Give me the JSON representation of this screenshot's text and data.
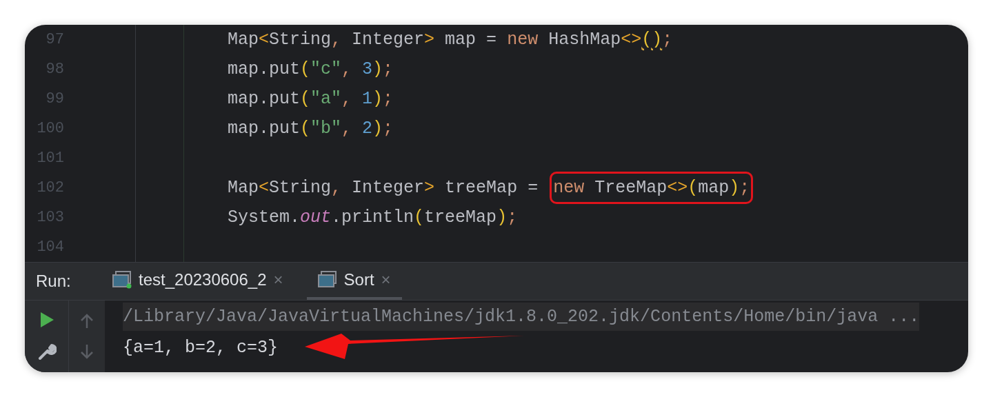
{
  "editor": {
    "lines": [
      {
        "number": "97",
        "tokens": [
          {
            "t": "Map",
            "kind": "plain"
          },
          {
            "t": "<",
            "kind": "angle"
          },
          {
            "t": "String",
            "kind": "plain"
          },
          {
            "t": ",",
            "kind": "punct"
          },
          {
            "t": " Integer",
            "kind": "plain"
          },
          {
            "t": ">",
            "kind": "angle"
          },
          {
            "t": " map = ",
            "kind": "plain"
          },
          {
            "t": "new",
            "kind": "keyword"
          },
          {
            "t": " HashMap",
            "kind": "plain"
          },
          {
            "t": "<>",
            "kind": "angle"
          },
          {
            "t": "()",
            "kind": "warn"
          },
          {
            "t": ";",
            "kind": "punct"
          }
        ]
      },
      {
        "number": "98",
        "tokens": [
          {
            "t": "map.put",
            "kind": "plain"
          },
          {
            "t": "(",
            "kind": "paren"
          },
          {
            "t": "\"c\"",
            "kind": "string"
          },
          {
            "t": ",",
            "kind": "punct"
          },
          {
            "t": " 3",
            "kind": "number"
          },
          {
            "t": ")",
            "kind": "paren"
          },
          {
            "t": ";",
            "kind": "punct"
          }
        ]
      },
      {
        "number": "99",
        "tokens": [
          {
            "t": "map.put",
            "kind": "plain"
          },
          {
            "t": "(",
            "kind": "paren"
          },
          {
            "t": "\"a\"",
            "kind": "string"
          },
          {
            "t": ",",
            "kind": "punct"
          },
          {
            "t": " 1",
            "kind": "number"
          },
          {
            "t": ")",
            "kind": "paren"
          },
          {
            "t": ";",
            "kind": "punct"
          }
        ]
      },
      {
        "number": "100",
        "tokens": [
          {
            "t": "map.put",
            "kind": "plain"
          },
          {
            "t": "(",
            "kind": "paren"
          },
          {
            "t": "\"b\"",
            "kind": "string"
          },
          {
            "t": ",",
            "kind": "punct"
          },
          {
            "t": " 2",
            "kind": "number"
          },
          {
            "t": ")",
            "kind": "paren"
          },
          {
            "t": ";",
            "kind": "punct"
          }
        ]
      },
      {
        "number": "101"
      },
      {
        "number": "102",
        "tokens": [
          {
            "t": "Map",
            "kind": "plain"
          },
          {
            "t": "<",
            "kind": "angle"
          },
          {
            "t": "String",
            "kind": "plain"
          },
          {
            "t": ",",
            "kind": "punct"
          },
          {
            "t": " Integer",
            "kind": "plain"
          },
          {
            "t": ">",
            "kind": "angle"
          },
          {
            "t": " treeMap = ",
            "kind": "plain"
          }
        ],
        "boxed_tokens": [
          {
            "t": "new",
            "kind": "keyword"
          },
          {
            "t": " TreeMap",
            "kind": "plain"
          },
          {
            "t": "<>",
            "kind": "angle"
          },
          {
            "t": "(",
            "kind": "paren"
          },
          {
            "t": "map",
            "kind": "plain"
          },
          {
            "t": ")",
            "kind": "paren"
          },
          {
            "t": ";",
            "kind": "punct"
          }
        ]
      },
      {
        "number": "103",
        "tokens": [
          {
            "t": "System.",
            "kind": "plain"
          },
          {
            "t": "out",
            "kind": "field"
          },
          {
            "t": ".println",
            "kind": "plain"
          },
          {
            "t": "(",
            "kind": "paren"
          },
          {
            "t": "treeMap",
            "kind": "plain"
          },
          {
            "t": ")",
            "kind": "paren"
          },
          {
            "t": ";",
            "kind": "punct"
          }
        ]
      },
      {
        "number": "104"
      }
    ]
  },
  "run_panel": {
    "label": "Run:",
    "tabs": [
      {
        "label": "test_20230606_2",
        "close": "×",
        "selected": false,
        "running": true
      },
      {
        "label": "Sort",
        "close": "×",
        "selected": true,
        "running": false
      }
    ],
    "console": [
      {
        "kind": "command",
        "text": "/Library/Java/JavaVirtualMachines/jdk1.8.0_202.jdk/Contents/Home/bin/java ..."
      },
      {
        "kind": "output",
        "text": "{a=1, b=2, c=3}"
      }
    ]
  },
  "annotation": {
    "kind": "arrow"
  }
}
